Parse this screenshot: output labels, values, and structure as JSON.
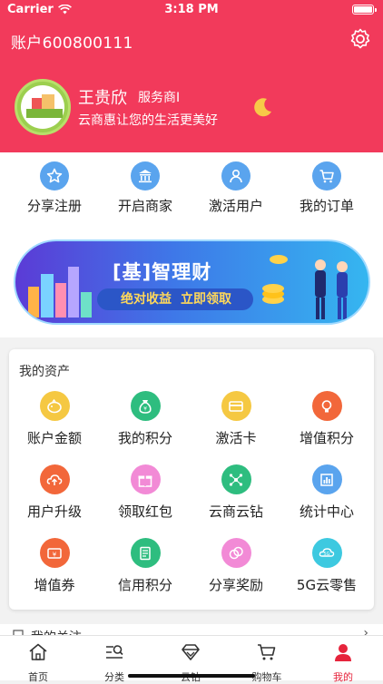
{
  "status_bar": {
    "carrier": "Carrier",
    "time": "3:18 PM"
  },
  "header": {
    "account_title": "账户600800111",
    "user_name": "王贵欣",
    "user_role": "服务商I",
    "slogan": "云商惠让您的生活更美好"
  },
  "quick_actions": [
    {
      "label": "分享注册",
      "icon": "star-icon"
    },
    {
      "label": "开启商家",
      "icon": "store-icon"
    },
    {
      "label": "激活用户",
      "icon": "user-icon"
    },
    {
      "label": "我的订单",
      "icon": "cart-icon"
    }
  ],
  "banner": {
    "title": "[基]智理财",
    "tag1": "绝对收益",
    "tag2": "立即领取"
  },
  "assets": {
    "title": "我的资产",
    "items": [
      {
        "label": "账户金额",
        "icon": "piggy-bank-icon",
        "color": "#f5c842"
      },
      {
        "label": "我的积分",
        "icon": "money-bag-icon",
        "color": "#2ebd7f"
      },
      {
        "label": "激活卡",
        "icon": "card-icon",
        "color": "#f5c842"
      },
      {
        "label": "增值积分",
        "icon": "bulb-icon",
        "color": "#f2673a"
      },
      {
        "label": "用户升级",
        "icon": "cloud-upload-icon",
        "color": "#f2673a"
      },
      {
        "label": "领取红包",
        "icon": "gift-icon",
        "color": "#f28ad6"
      },
      {
        "label": "云商云钻",
        "icon": "network-icon",
        "color": "#2ebd7f"
      },
      {
        "label": "统计中心",
        "icon": "chart-icon",
        "color": "#5aa4ee"
      },
      {
        "label": "增值券",
        "icon": "coupon-icon",
        "color": "#f2673a"
      },
      {
        "label": "信用积分",
        "icon": "document-icon",
        "color": "#2ebd7f"
      },
      {
        "label": "分享奖励",
        "icon": "coins-icon",
        "color": "#f28ad6"
      },
      {
        "label": "5G云零售",
        "icon": "5g-icon",
        "color": "#3dc9e0"
      }
    ]
  },
  "partial_section": {
    "label": "我的关注"
  },
  "tabbar": [
    {
      "label": "首页",
      "icon": "home-icon"
    },
    {
      "label": "分类",
      "icon": "category-search-icon"
    },
    {
      "label": "云钻",
      "icon": "diamond-icon"
    },
    {
      "label": "购物车",
      "icon": "cart-icon"
    },
    {
      "label": "我的",
      "icon": "profile-icon",
      "active": true
    }
  ],
  "colors": {
    "brand": "#f23a5b",
    "accent_blue": "#5aa4ee",
    "active_tab": "#e6243c"
  }
}
